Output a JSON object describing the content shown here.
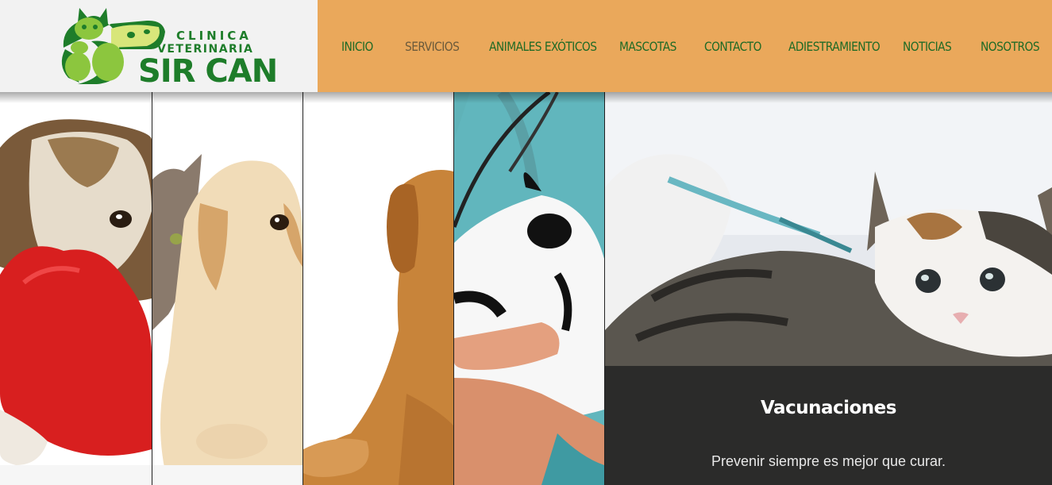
{
  "brand": {
    "line1": "CLINICA",
    "line2": "VETERINARIA",
    "name": "SIR CAN",
    "logo_green": "#1e7d2a",
    "logo_light": "#8cc63e"
  },
  "nav": [
    {
      "label": "INICIO",
      "active": false
    },
    {
      "label": "SERVICIOS",
      "active": true
    },
    {
      "label": "ANIMALES EXÓTICOS",
      "active": false
    },
    {
      "label": "MASCOTAS",
      "active": false
    },
    {
      "label": "CONTACTO",
      "active": false
    },
    {
      "label": "ADIESTRAMIENTO",
      "active": false
    },
    {
      "label": "NOTICIAS",
      "active": false
    },
    {
      "label": "NOSOTROS",
      "active": false
    }
  ],
  "colors": {
    "nav_bg": "#eaa85b",
    "nav_text": "#1f6a25",
    "nav_active_text": "#6b5a3b",
    "logo_bg": "#f2f2f2"
  },
  "hero": {
    "panels": [
      {
        "subject": "puppy with red heart"
      },
      {
        "subject": "kitten and labrador puppy"
      },
      {
        "subject": "golden retriever"
      },
      {
        "subject": "vet holding rabbit"
      },
      {
        "subject": "kitten vaccination"
      }
    ],
    "caption": {
      "title": "Vacunaciones",
      "text": "Prevenir siempre es mejor que curar."
    }
  }
}
